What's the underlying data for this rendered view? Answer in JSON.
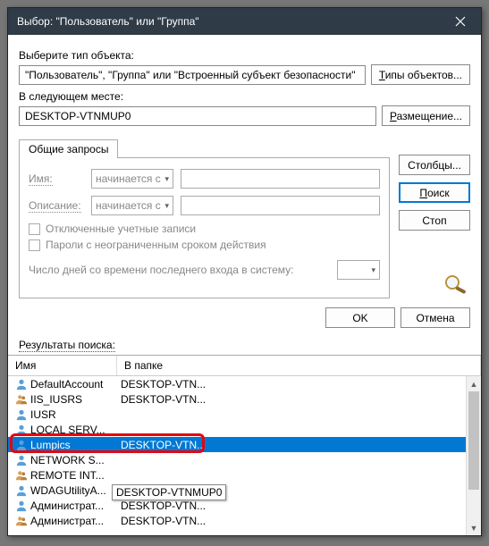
{
  "window": {
    "title": "Выбор: \"Пользователь\" или \"Группа\""
  },
  "labels": {
    "object_type": "Выберите тип объекта:",
    "location": "В следующем месте:",
    "results": "Результаты поиска:",
    "common_queries_tab": "Общие запросы",
    "name": "Имя:",
    "description": "Описание:",
    "disabled_accounts": "Отключенные учетные записи",
    "no_expiry": "Пароли с неограниченным сроком действия",
    "days_since": "Число дней со времени последнего входа в систему:"
  },
  "fields": {
    "object_type_value": "\"Пользователь\", \"Группа\" или \"Встроенный субъект безопасности\"",
    "location_value": "DESKTOP-VTNMUP0",
    "combo_startswith": "начинается с"
  },
  "buttons": {
    "object_types": "Типы объектов...",
    "locations": "Размещение...",
    "columns": "Столбцы...",
    "search": "Поиск",
    "stop": "Стоп",
    "ok": "OK",
    "cancel": "Отмена"
  },
  "grid": {
    "col_name": "Имя",
    "col_folder": "В папке",
    "rows": [
      {
        "name": "DefaultAccount",
        "folder": "DESKTOP-VTN...",
        "type": "user"
      },
      {
        "name": "IIS_IUSRS",
        "folder": "DESKTOP-VTN...",
        "type": "group"
      },
      {
        "name": "IUSR",
        "folder": "",
        "type": "user"
      },
      {
        "name": "LOCAL SERV...",
        "folder": "",
        "type": "user"
      },
      {
        "name": "Lumpics",
        "folder": "DESKTOP-VTN...",
        "type": "user",
        "selected": true
      },
      {
        "name": "NETWORK S...",
        "folder": "",
        "type": "user"
      },
      {
        "name": "REMOTE INT...",
        "folder": "",
        "type": "group"
      },
      {
        "name": "WDAGUtilityA...",
        "folder": "DESKTOP-VTN...",
        "type": "user"
      },
      {
        "name": "Администрат...",
        "folder": "DESKTOP-VTN...",
        "type": "user"
      },
      {
        "name": "Администрат...",
        "folder": "DESKTOP-VTN...",
        "type": "group"
      }
    ]
  },
  "tooltip": "DESKTOP-VTNMUP0",
  "highlight_row_index": 4
}
